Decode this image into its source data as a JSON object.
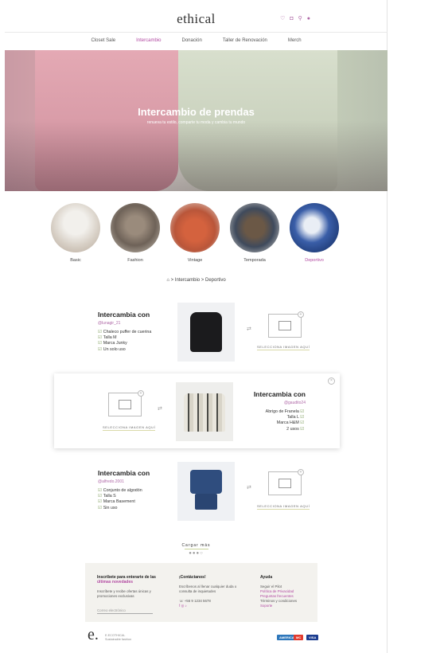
{
  "header": {
    "logo": "ethical",
    "icons": [
      "heart-icon",
      "bag-icon",
      "search-icon",
      "user-icon"
    ]
  },
  "nav": {
    "items": [
      "Closet Sale",
      "Intercambio",
      "Donación",
      "Taller de Renovación",
      "Merch"
    ],
    "active": "Intercambio"
  },
  "hero": {
    "title": "Intercambio de prendas",
    "subtitle": "renueva tu estilo, comparte tu moda y cambia tu mundo"
  },
  "categories": [
    {
      "label": "Basic"
    },
    {
      "label": "Fashion"
    },
    {
      "label": "Vintage"
    },
    {
      "label": "Temporada"
    },
    {
      "label": "Deportivo"
    }
  ],
  "active_category": "Deportivo",
  "breadcrumb": "> Intercambio > Deportivo",
  "cards": [
    {
      "title": "Intercambia con",
      "user": "@lunagir_21",
      "items": [
        "Chaleco puffer de cuerina",
        "Talla M",
        "Marca Junky",
        "Un solo uso"
      ],
      "select_label": "SELECCIONA IMAGEN AQUÍ"
    },
    {
      "title": "Intercambia con",
      "user": "@gaudito24",
      "items": [
        "Abrigo de Franela",
        "Talla L",
        "Marca H&M",
        "2 usos"
      ],
      "select_label": "SELECCIONA IMAGEN AQUÍ"
    },
    {
      "title": "Intercambia con",
      "user": "@alfredo.2001",
      "items": [
        "Conjunto de algodón",
        "Talla S",
        "Marca Basement",
        "Sin uso"
      ],
      "select_label": "SELECCIONA IMAGEN AQUÍ"
    }
  ],
  "load_more": "Cargar más",
  "footer": {
    "newsletter_title": "Inscríbete para enterarte de las",
    "newsletter_highlight": "últimas novedades",
    "newsletter_text": "Inscríbete y recibe ofertas únicas y promociones exclusivas",
    "newsletter_placeholder": "Correo electrónico",
    "contact_title": "¡Contáctanos!",
    "contact_text": "Escríbenos al llenar cualquier duda o consulta de inquietudes",
    "contact_phone": "+56 9 1234 5678",
    "help_title": "Ayuda",
    "help_links": [
      "Seguir el Pilot",
      "Política de Privacidad",
      "Preguntas frecuentes",
      "Términos y condiciones",
      "Soporte"
    ],
    "brand_line1": "E.ECOTHICAL",
    "brand_line2": "Sustainable fashion",
    "payments": [
      "AMERICAN",
      "MC",
      "VISA"
    ]
  },
  "colors": {
    "accent": "#b24aa2",
    "check": "#7a9a58",
    "footer_bg": "#f3f2ee"
  }
}
